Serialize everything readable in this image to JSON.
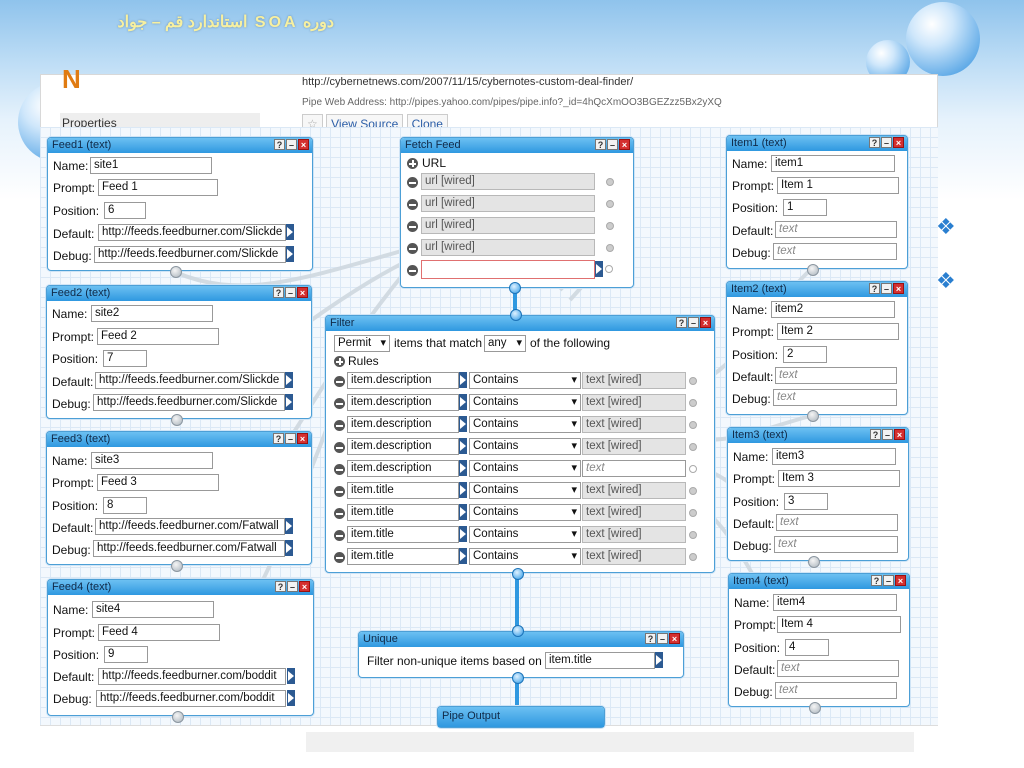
{
  "slide_title": "دوره SOA استاندارد قم – جواد",
  "page": {
    "logo": "N",
    "properties_label": "Properties",
    "url": "http://cybernetnews.com/2007/11/15/cybernotes-custom-deal-finder/",
    "web_address": "Pipe Web Address: http://pipes.yahoo.com/pipes/pipe.info?_id=4hQcXmOO3BGEZzz5Bx2yXQ",
    "view_source": "View Source",
    "clone": "Clone"
  },
  "labels": {
    "name": "Name:",
    "prompt": "Prompt:",
    "position": "Position:",
    "default": "Default:",
    "debug": "Debug:"
  },
  "feeds": [
    {
      "title": "Feed1 (text)",
      "name": "site1",
      "prompt": "Feed 1",
      "position": "6",
      "default": "http://feeds.feedburner.com/Slickde",
      "debug": "http://feeds.feedburner.com/Slickde"
    },
    {
      "title": "Feed2 (text)",
      "name": "site2",
      "prompt": "Feed 2",
      "position": "7",
      "default": "http://feeds.feedburner.com/Slickde",
      "debug": "http://feeds.feedburner.com/Slickde"
    },
    {
      "title": "Feed3 (text)",
      "name": "site3",
      "prompt": "Feed 3",
      "position": "8",
      "default": "http://feeds.feedburner.com/Fatwall",
      "debug": "http://feeds.feedburner.com/Fatwall"
    },
    {
      "title": "Feed4 (text)",
      "name": "site4",
      "prompt": "Feed 4",
      "position": "9",
      "default": "http://feeds.feedburner.com/boddit",
      "debug": "http://feeds.feedburner.com/boddit"
    }
  ],
  "items": [
    {
      "title": "Item1 (text)",
      "name": "item1",
      "prompt": "Item 1",
      "position": "1",
      "default": "text",
      "debug": "text"
    },
    {
      "title": "Item2 (text)",
      "name": "item2",
      "prompt": "Item 2",
      "position": "2",
      "default": "text",
      "debug": "text"
    },
    {
      "title": "Item3 (text)",
      "name": "item3",
      "prompt": "Item 3",
      "position": "3",
      "default": "text",
      "debug": "text"
    },
    {
      "title": "Item4 (text)",
      "name": "item4",
      "prompt": "Item 4",
      "position": "4",
      "default": "text",
      "debug": "text"
    }
  ],
  "fetch": {
    "title": "Fetch Feed",
    "url_label": "URL",
    "inputs": [
      "url [wired]",
      "url [wired]",
      "url [wired]",
      "url [wired]",
      ""
    ]
  },
  "filter": {
    "title": "Filter",
    "mode": "Permit",
    "text1": "items that match",
    "match": "any",
    "text2": "of the following",
    "rules_label": "Rules",
    "rules": [
      {
        "field": "item.description",
        "op": "Contains",
        "value": "text [wired]",
        "wired": true
      },
      {
        "field": "item.description",
        "op": "Contains",
        "value": "text [wired]",
        "wired": true
      },
      {
        "field": "item.description",
        "op": "Contains",
        "value": "text [wired]",
        "wired": true
      },
      {
        "field": "item.description",
        "op": "Contains",
        "value": "text [wired]",
        "wired": true
      },
      {
        "field": "item.description",
        "op": "Contains",
        "value": "text",
        "wired": false
      },
      {
        "field": "item.title",
        "op": "Contains",
        "value": "text [wired]",
        "wired": true
      },
      {
        "field": "item.title",
        "op": "Contains",
        "value": "text [wired]",
        "wired": true
      },
      {
        "field": "item.title",
        "op": "Contains",
        "value": "text [wired]",
        "wired": true
      },
      {
        "field": "item.title",
        "op": "Contains",
        "value": "text [wired]",
        "wired": true
      }
    ]
  },
  "unique": {
    "title": "Unique",
    "text": "Filter non-unique items based on",
    "field": "item.title"
  },
  "output": {
    "title": "Pipe Output"
  },
  "colors": {
    "header": "#2f98e0",
    "border": "#4c9fd6",
    "wire": "#cfd8e0",
    "accent_wire": "#2f98e0"
  }
}
